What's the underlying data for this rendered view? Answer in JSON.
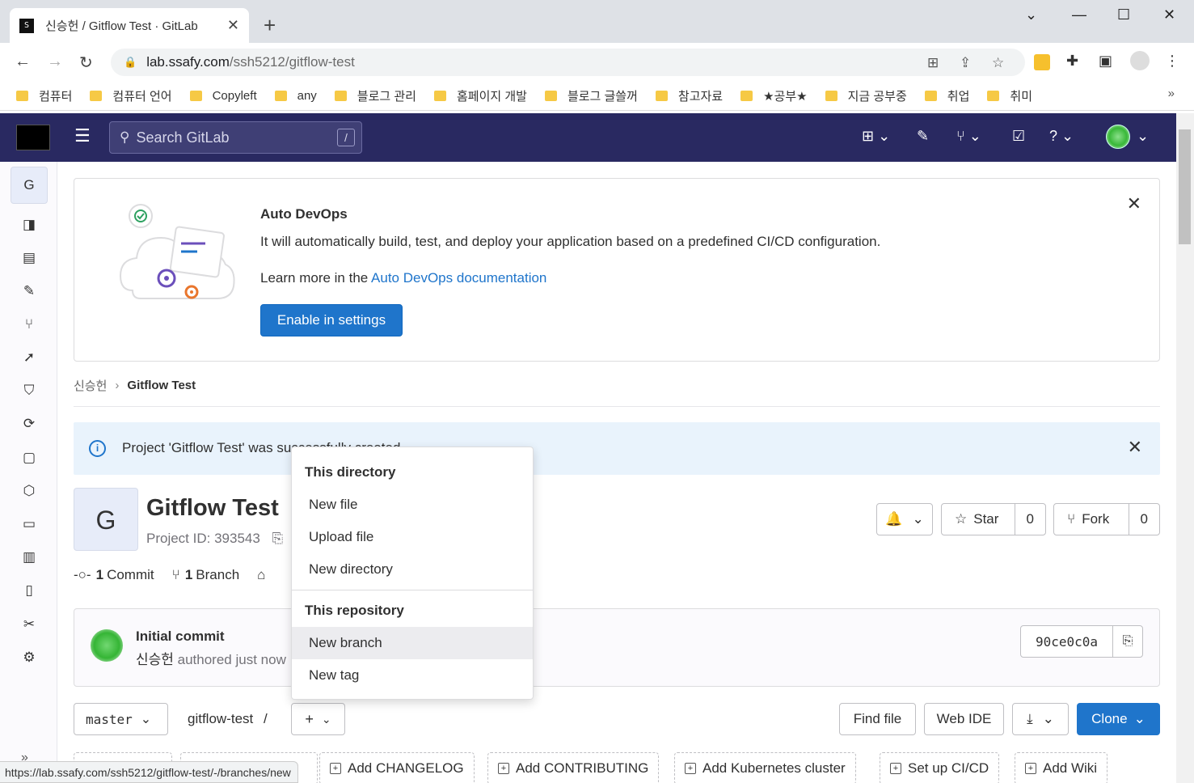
{
  "browser": {
    "tab_title": "신승헌 / Gitflow Test · GitLab",
    "favicon_text": "S",
    "url_host": "lab.ssafy.com",
    "url_path": "/ssh5212/gitflow-test",
    "bookmarks": [
      "컴퓨터",
      "컴퓨터 언어",
      "Copyleft",
      "any",
      "블로그 관리",
      "홈페이지 개발",
      "블로그 글쓸꺼",
      "참고자료",
      "★공부★",
      "지금 공부중",
      "취업",
      "취미"
    ],
    "status_url": "https://lab.ssafy.com/ssh5212/gitflow-test/-/branches/new"
  },
  "gitlab": {
    "search_placeholder": "Search GitLab",
    "search_shortcut": "/",
    "sidebar_project_letter": "G"
  },
  "autodevops": {
    "title": "Auto DevOps",
    "description": "It will automatically build, test, and deploy your application based on a predefined CI/CD configuration.",
    "learn_prefix": "Learn more in the ",
    "learn_link": "Auto DevOps documentation",
    "button": "Enable in settings"
  },
  "breadcrumb": {
    "parent": "신승헌",
    "current": "Gitflow Test"
  },
  "alert": {
    "text": "Project 'Gitflow Test' was successfully created."
  },
  "project": {
    "avatar_letter": "G",
    "name": "Gitflow Test",
    "id_label": "Project ID: 393543",
    "star_label": "Star",
    "star_count": "0",
    "fork_label": "Fork",
    "fork_count": "0",
    "commits_num": "1",
    "commits_label": "Commit",
    "branches_num": "1",
    "branches_label": "Branch"
  },
  "commit": {
    "title": "Initial commit",
    "author": "신승헌",
    "meta": " authored just now",
    "sha": "90ce0c0a"
  },
  "repo": {
    "branch": "master",
    "path": "gitflow-test",
    "path_sep": "/",
    "find_file": "Find file",
    "web_ide": "Web IDE",
    "clone": "Clone"
  },
  "quick_actions": [
    "Add CHANGELOG",
    "Add CONTRIBUTING",
    "Add Kubernetes cluster",
    "Set up CI/CD",
    "Add Wiki"
  ],
  "dropdown": {
    "section1": "This directory",
    "items1": [
      "New file",
      "Upload file",
      "New directory"
    ],
    "section2": "This repository",
    "items2": [
      "New branch",
      "New tag"
    ]
  },
  "colors": {
    "gitlab_nav": "#292961",
    "primary": "#1f75cb",
    "alert_bg": "#e9f3fc"
  }
}
